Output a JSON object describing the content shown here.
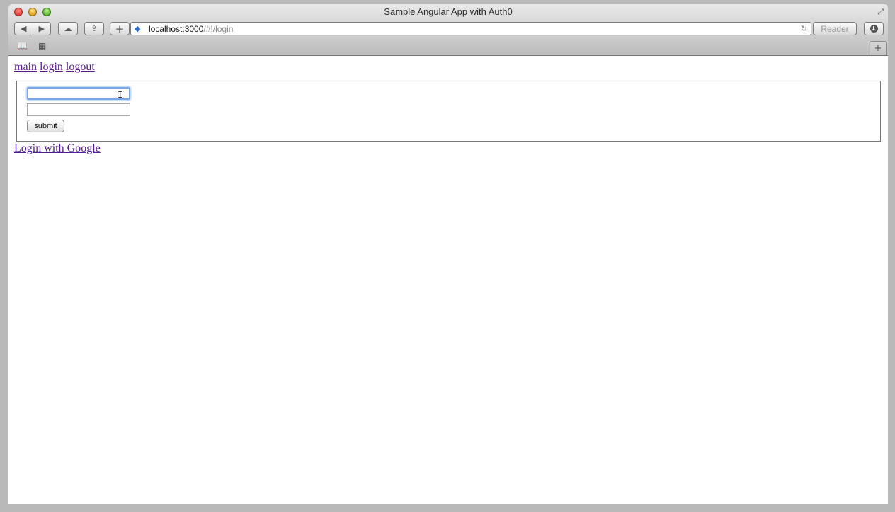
{
  "window": {
    "title": "Sample Angular App with Auth0"
  },
  "toolbar": {
    "back_icon": "◀",
    "forward_icon": "▶",
    "icloud_icon": "☁",
    "share_icon": "⇪",
    "new_tab_icon": "+",
    "reader_label": "Reader",
    "download_icon": "⬇"
  },
  "address_bar": {
    "host": "localhost:3000",
    "path": "/#!/login",
    "site_icon": "◆",
    "reload_icon": "↻"
  },
  "bookmarks": {
    "book_icon": "📖",
    "grid_icon": "▦"
  },
  "tab_bar": {
    "add_tab_icon": "+"
  },
  "page": {
    "nav_links": [
      "main",
      "login",
      "logout"
    ],
    "login_form": {
      "username_value": "",
      "password_value": "",
      "submit_label": "submit"
    },
    "google_link": "Login with Google"
  }
}
